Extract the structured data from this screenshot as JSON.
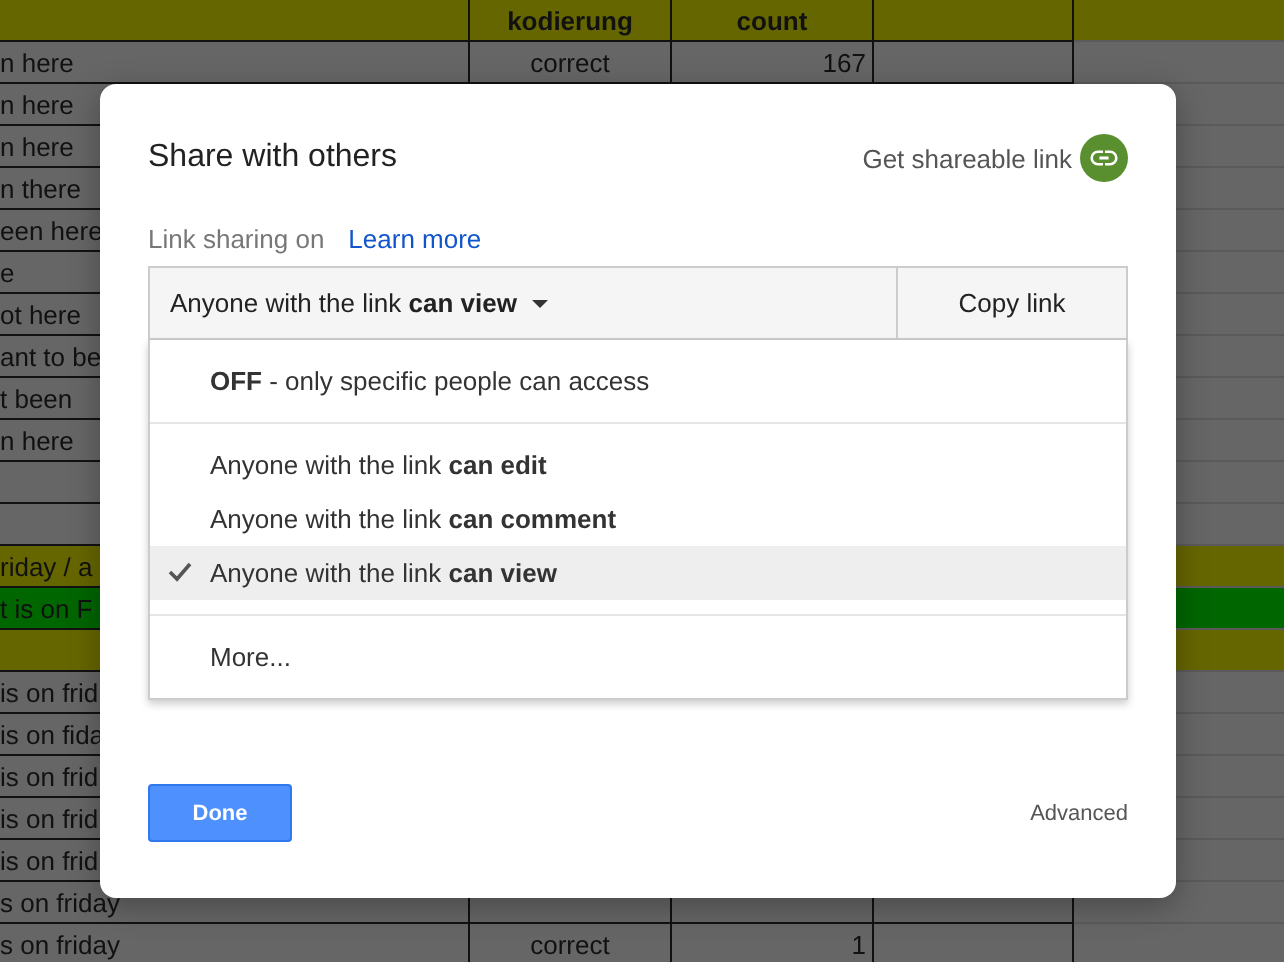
{
  "sheet": {
    "header": {
      "column_2": "kodierung",
      "column_3": "count"
    },
    "rows": [
      {
        "color": "#666666",
        "cells": {
          "column_1": "n here",
          "column_2": "correct",
          "column_3": "167"
        }
      },
      {
        "color": "#666666",
        "cells": {
          "column_1": "n here"
        }
      },
      {
        "color": "#666666",
        "cells": {
          "column_1": "n here"
        }
      },
      {
        "color": "#666666",
        "cells": {
          "column_1": "n there"
        }
      },
      {
        "color": "#666666",
        "cells": {
          "column_1": "een here"
        }
      },
      {
        "color": "#666666",
        "cells": {
          "column_1": "e"
        }
      },
      {
        "color": "#666666",
        "cells": {
          "column_1": "ot here"
        }
      },
      {
        "color": "#666666",
        "cells": {
          "column_1": "ant to be"
        }
      },
      {
        "color": "#666666",
        "cells": {
          "column_1": "t been"
        }
      },
      {
        "color": "#666666",
        "cells": {
          "column_1": "n here"
        }
      },
      {
        "color": "#666666",
        "cells": {}
      },
      {
        "color": "#666666",
        "cells": {}
      },
      {
        "color": "#666600",
        "cells": {
          "column_1": "riday / a"
        }
      },
      {
        "color": "#006600",
        "cells": {
          "column_1": "t is on F"
        }
      },
      {
        "color": "#666600",
        "cells": {}
      },
      {
        "color": "#666666",
        "cells": {
          "column_1": "is on frid"
        }
      },
      {
        "color": "#666666",
        "cells": {
          "column_1": "is on fida"
        }
      },
      {
        "color": "#666666",
        "cells": {
          "column_1": "is on frid"
        }
      },
      {
        "color": "#666666",
        "cells": {
          "column_1": "is on frid"
        }
      },
      {
        "color": "#666666",
        "cells": {
          "column_1": "is on frid"
        }
      },
      {
        "color": "#666666",
        "cells": {
          "column_1": "s on friday"
        }
      },
      {
        "color": "#666666",
        "cells": {
          "column_1": "s on friday",
          "column_2": "correct",
          "column_3": "1"
        }
      }
    ]
  },
  "dialog": {
    "title": "Share with others",
    "shareable_link": "Get shareable link",
    "link_sharing_label": "Link sharing on",
    "learn_more": "Learn more",
    "access_dropdown": "Anyone with the link **can view**",
    "copy_link": "Copy link",
    "menu_groups": [
      [
        {
          "label": "**OFF** - only specific people can access",
          "selected": false
        }
      ],
      [
        {
          "label": "Anyone with the link **can edit**",
          "selected": false
        },
        {
          "label": "Anyone with the link **can comment**",
          "selected": false
        },
        {
          "label": "Anyone with the link **can view**",
          "selected": true
        }
      ],
      [
        {
          "label": "More...",
          "selected": false
        }
      ]
    ],
    "done": "Done",
    "advanced": "Advanced"
  }
}
